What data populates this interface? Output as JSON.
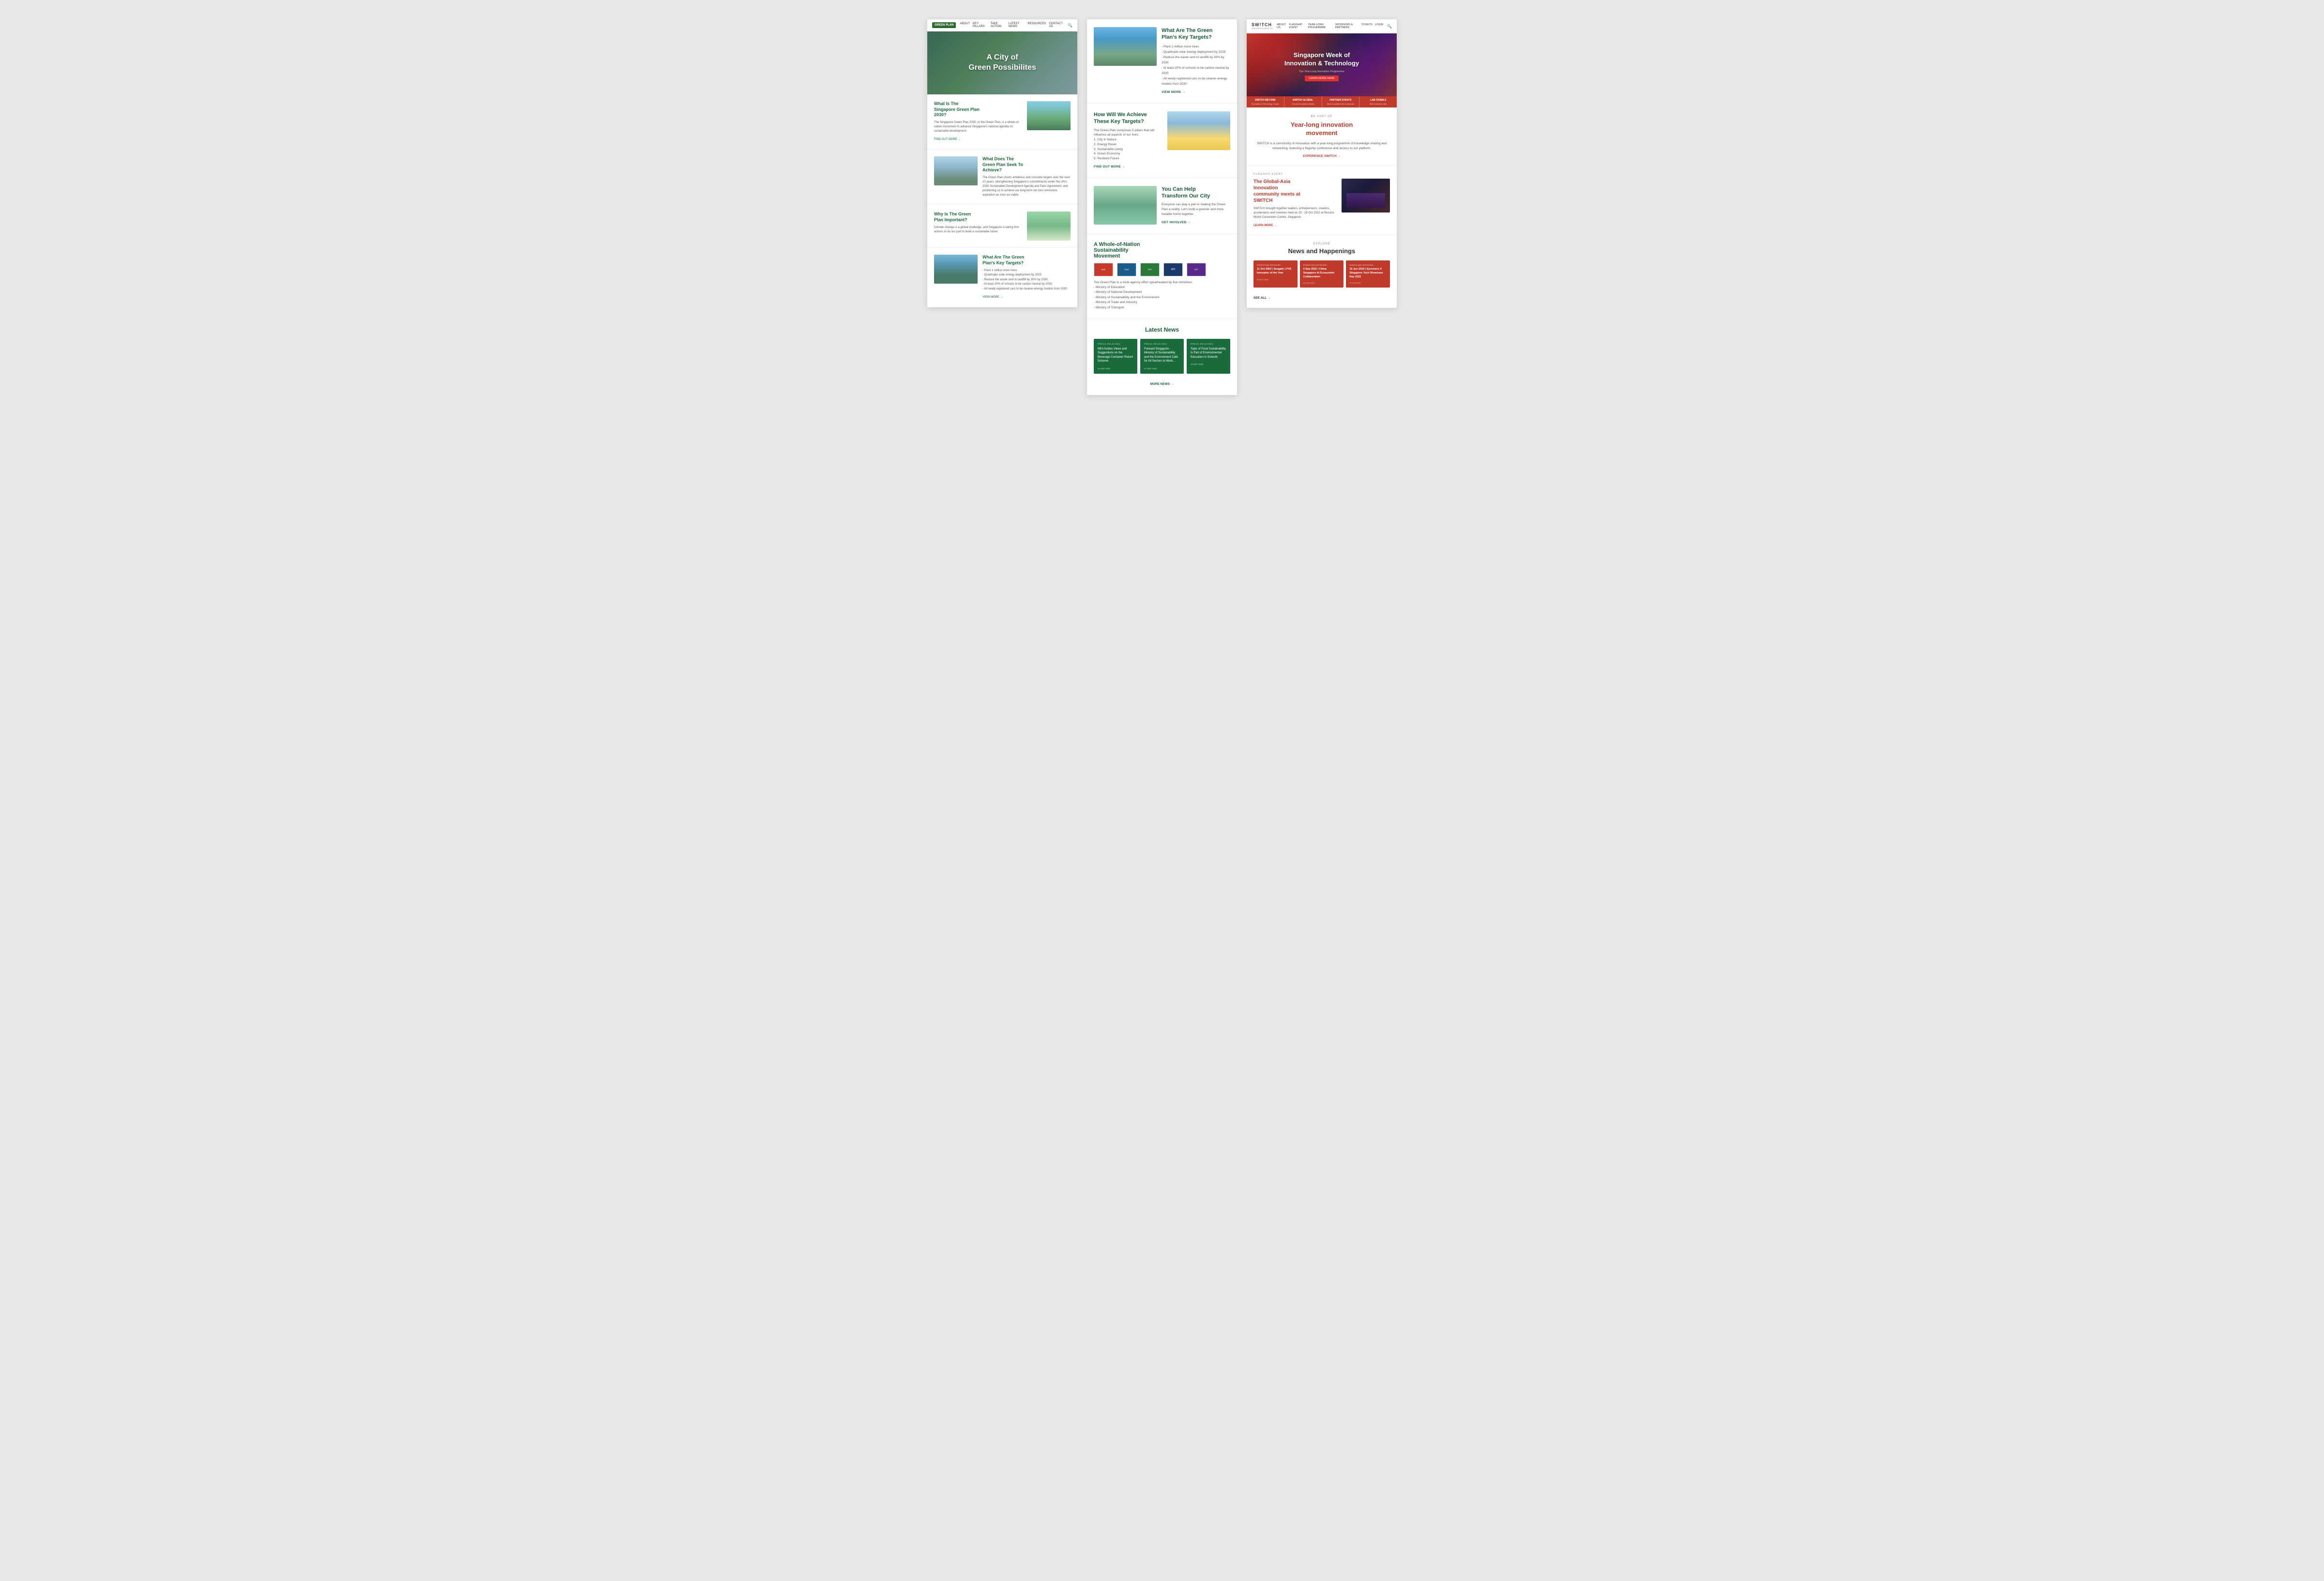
{
  "panel1": {
    "logo": "GREEN PLAN",
    "nav": {
      "links": [
        "ABOUT",
        "KEY PILLARS",
        "TAKE ACTION",
        "LATEST NEWS",
        "RESOURCES",
        "CONTACT US"
      ]
    },
    "hero": {
      "title": "A City of\nGreen Possibilites"
    },
    "sections": [
      {
        "title": "What Is The\nSingapore Green Plan\n2030?",
        "body": "The Singapore Green Plan 2030, or the Green Plan, is a whole-of-nation movement to advance Singapore's national agenda on sustainable development.",
        "link": "FIND OUT MORE →"
      },
      {
        "title": "What Does The\nGreen Plan Seek To\nAchieve?",
        "body": "The Green Plan charts ambitious and concrete targets over the next 10 years, strengthening Singapore's commitments under the UN's 2030 Sustainable Development Agenda and Paris Agreement, and positioning us to achieve our long-term net zero emissions aspiration as soon as viable.",
        "link": ""
      },
      {
        "title": "Why Is The Green\nPlan Important?",
        "body": "Climate change is a global challenge, and Singapore is taking firm actions to do our part to build a sustainable future.",
        "link": ""
      },
      {
        "title": "What Are The Green\nPlan's Key Targets?",
        "targets": [
          "- Plant 1 million more trees",
          "- Quadruple solar energy deployment by 2025",
          "- Reduce the waste sent to landfill by 30% by 2030",
          "- At least 20% of schools to be carbon neutral by 2030",
          "- All newly registered cars to be cleaner-energy models from 2030"
        ],
        "link": "VIEW MORE →"
      }
    ]
  },
  "panel2": {
    "sections": [
      {
        "id": "key-targets",
        "title": "What Are The Green\nPlan's Key Targets?",
        "targets": [
          "- Plant 1 million more trees",
          "- Quadruple solar energy deployment by 2025",
          "- Reduce the waste sent to landfill by 30% by 2030",
          "- At least 20% of schools to be carbon neutral by 2030",
          "- All newly registered cars to be cleaner-energy models from 2030"
        ],
        "link": "VIEW MORE →",
        "hasImage": true,
        "imageType": "aerial"
      },
      {
        "id": "achieve-targets",
        "title": "How Will We Achieve\nThese Key Targets?",
        "body": "The Green Plan comprises 5 pillars that will influence all aspects of our lives:\n1. City In Nature\n2. Energy Reset\n3. Sustainable Living\n4. Green Economy\n5. Resilient Future",
        "link": "FIND OUT MORE →",
        "hasImage": true,
        "imageType": "solar"
      },
      {
        "id": "help-transform",
        "title": "You Can Help\nTransform Our City",
        "body": "Everyone can play a part in making the Green Plan a reality. Let's build a greener and more liveable home together.",
        "link": "GET INVOLVED →",
        "hasImage": true,
        "imageType": "family"
      }
    ],
    "wholeoNation": {
      "title": "A Whole-of-Nation\nSustainability\nMovement",
      "body": "The Green Plan is a multi-agency effort spearheaded by five ministries:\n- Ministry of Education\n- Ministry of National Development\n- Ministry of Sustainability and the Environment\n- Ministry of Trade and Industry\n- Ministry of Transport",
      "logos": [
        "Ministry of Education",
        "MND",
        "Ministry of Sustainability",
        "MTI",
        "Ministry of Trade & Industry",
        "Ministry of Transport"
      ]
    },
    "latestNews": {
      "title": "Latest News",
      "cards": [
        {
          "tag": "PRESS RELEASES",
          "headline": "NEA Invites Views and Suggestions on the Beverage Container Return Scheme",
          "date": "22 SEP 2022"
        },
        {
          "tag": "PRESS RELEASES",
          "headline": "Forward Singapore - Ministry of Sustainability and the Environment Calls for All Sectors to Work...",
          "date": "07 SEP 2022"
        },
        {
          "tag": "PRESS RELEASES",
          "headline": "Topic of Food Sustainability Is Part of Environmental Education in Schools",
          "date": "16 SEP 2022"
        }
      ],
      "moreLink": "MORE NEWS →"
    }
  },
  "panel3": {
    "logo": "SW!TCH",
    "logoSub": "INNOVATION WEEK SG",
    "nav": {
      "links": [
        "ABOUT US",
        "FLAGSHIP EVENT",
        "YEAR-LONG PROGRAMME",
        "SPONSORS & PARTNERS",
        "TICKETS",
        "LOGIN"
      ]
    },
    "hero": {
      "title": "Singapore Week of\nInnovation & Technology",
      "subtitle": "Our Year-Long Innovation Programme",
      "btnLabel": "LEARN MORE HERE"
    },
    "tabs": [
      {
        "title": "SWITCH BEYOND",
        "sub": "Innovation & Technology Transit"
      },
      {
        "title": "SWITCH GLOBAL",
        "sub": "Connect to global markets"
      },
      {
        "title": "PARTNER EVENTS",
        "sub": "More Innovation the community"
      },
      {
        "title": "LAB CRAWLS",
        "sub": "Mini innovation labs"
      }
    ],
    "innovation": {
      "label": "BE PART OF",
      "title": "Year-long innovation\nmovement",
      "body": "SWITCH is a community of innovation with a year-long programme of knowledge sharing and networking, featuring a flagship conference and access to our platform.",
      "link": "EXPERIENCE SWITCH →"
    },
    "flagship": {
      "label": "FLAGSHIP EVENT",
      "title": "The Global-Asia\nInnovation\ncommunity meets at\nSWITCH",
      "body": "SWITCH brought together leaders, entrepreneurs, creators, accelerators and investors held on 25 - 28 Oct 2022 at Resorts World Convention Centre, Singapore.",
      "link": "LEARN MORE →"
    },
    "news": {
      "label": "EXPLORE",
      "title": "News and Happenings",
      "cards": [
        {
          "tag": "EVENTS AND INITIATIVES",
          "title": "11 Oct 2022 | Seagate LYVE Innovator of the Year",
          "date": "09 OCT 2022"
        },
        {
          "tag": "EVENTS AND INITIATIVES",
          "title": "3 Sep 2022 | China Singapore AI Ecosystem Collaboration",
          "date": "31 AUG 2022"
        },
        {
          "tag": "EVENTS AND INITIATIVES",
          "title": "15 Jun 2022 | Eurostars X Singapore Tech Showcase Day 2022",
          "date": "07 JUN 2022"
        }
      ],
      "seeAll": "SEE ALL →"
    }
  }
}
